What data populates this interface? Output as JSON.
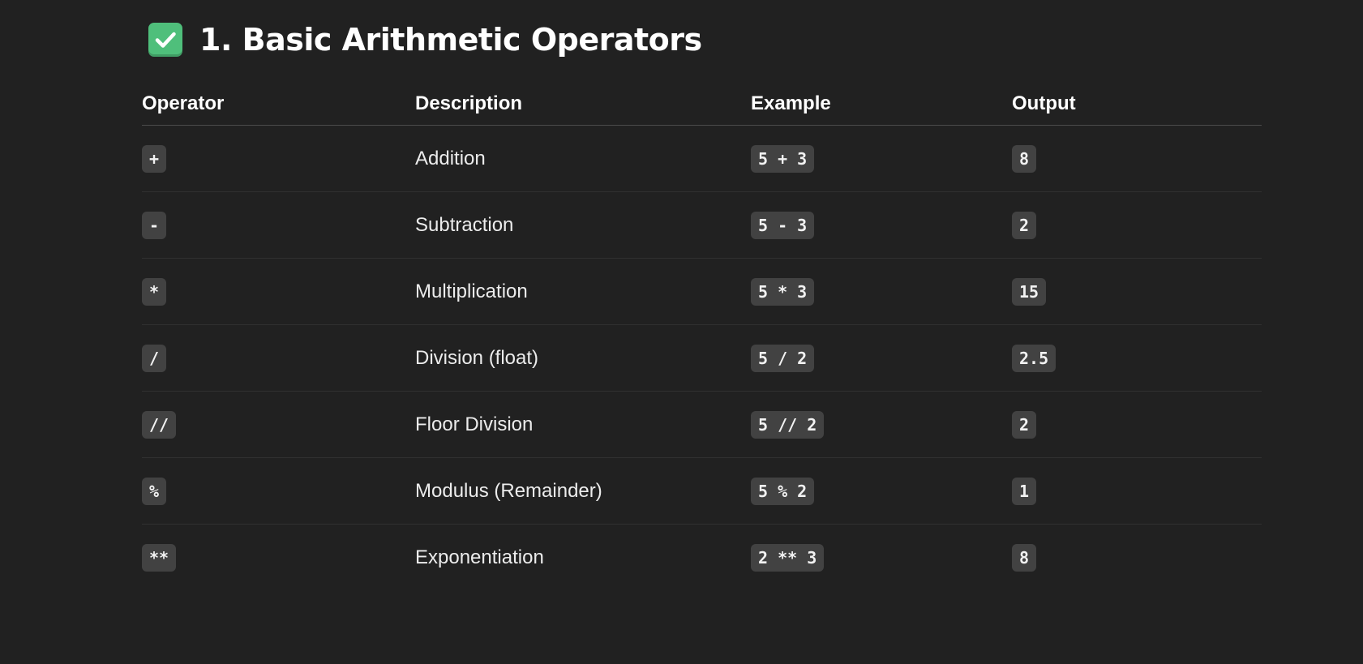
{
  "heading": {
    "icon": "check-mark-button-icon",
    "icon_color": "#4fbf7b",
    "title": "1. Basic Arithmetic Operators"
  },
  "table": {
    "headers": [
      "Operator",
      "Description",
      "Example",
      "Output"
    ],
    "rows": [
      {
        "operator": "+",
        "description": "Addition",
        "example": "5 + 3",
        "output": "8"
      },
      {
        "operator": "-",
        "description": "Subtraction",
        "example": "5 - 3",
        "output": "2"
      },
      {
        "operator": "*",
        "description": "Multiplication",
        "example": "5 * 3",
        "output": "15"
      },
      {
        "operator": "/",
        "description": "Division (float)",
        "example": "5 / 2",
        "output": "2.5"
      },
      {
        "operator": "//",
        "description": "Floor Division",
        "example": "5 // 2",
        "output": "2"
      },
      {
        "operator": "%",
        "description": "Modulus (Remainder)",
        "example": "5 % 2",
        "output": "1"
      },
      {
        "operator": "**",
        "description": "Exponentiation",
        "example": "2 ** 3",
        "output": "8"
      }
    ]
  }
}
